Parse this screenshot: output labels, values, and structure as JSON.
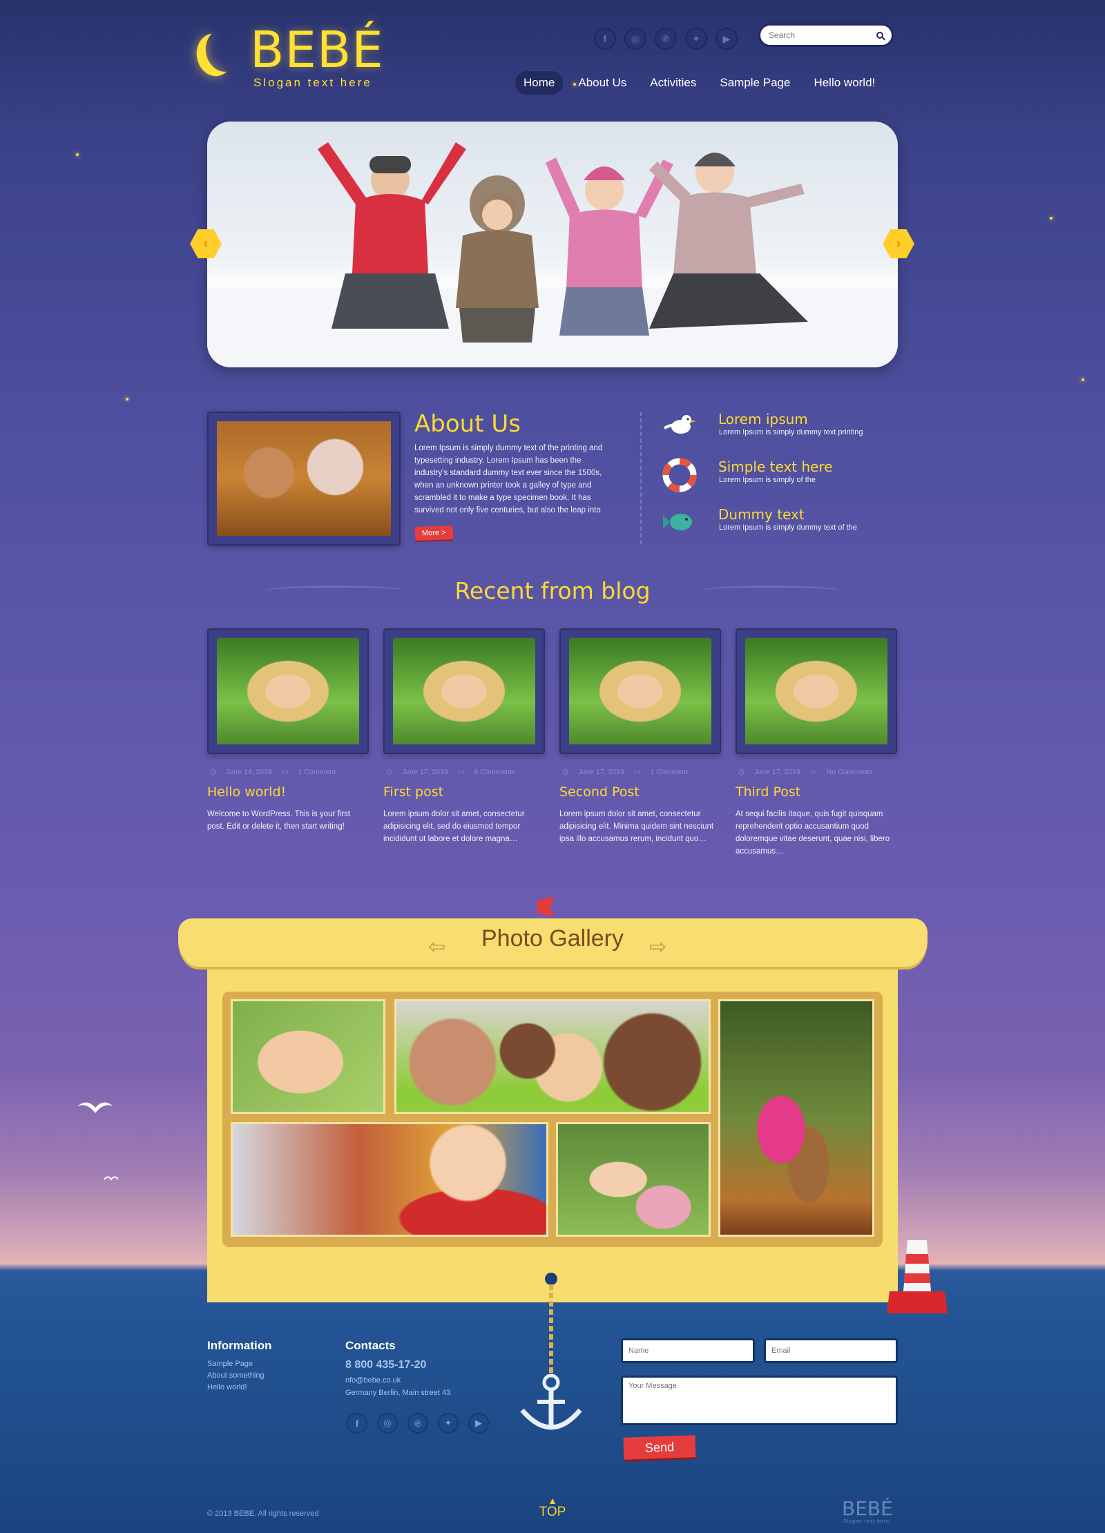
{
  "brand": {
    "logo": "BEBÉ",
    "slogan": "Slogan text here"
  },
  "search": {
    "placeholder": "Search"
  },
  "social": [
    "facebook-icon",
    "instagram-icon",
    "pinterest-icon",
    "twitter-icon",
    "youtube-icon"
  ],
  "social_glyphs": [
    "f",
    "◎",
    "℗",
    "✦",
    "▶"
  ],
  "nav": [
    {
      "label": "Home",
      "active": true
    },
    {
      "label": "About Us",
      "active": false
    },
    {
      "label": "Activities",
      "active": false
    },
    {
      "label": "Sample Page",
      "active": false
    },
    {
      "label": "Hello world!",
      "active": false
    }
  ],
  "slider": {
    "prev": "‹",
    "next": "›"
  },
  "about": {
    "title": "About Us",
    "text": "Lorem Ipsum is simply dummy text of the printing and typesetting industry. Lorem Ipsum has been the industry's standard dummy text ever since the 1500s, when an unknown printer took a galley of type and scrambled it to make a type specimen book. It has survived not only five centuries, but also the leap into",
    "more": "More >"
  },
  "features": [
    {
      "icon": "seagull-icon",
      "title": "Lorem ipsum",
      "text": "Lorem Ipsum is simply dummy text printing"
    },
    {
      "icon": "lifebuoy-icon",
      "title": "Simple text here",
      "text": "Lorem Ipsum is simply of the"
    },
    {
      "icon": "fish-icon",
      "title": "Dummy text",
      "text": "Lorem Ipsum is simply dummy text of the"
    }
  ],
  "blog": {
    "heading": "Recent from blog",
    "posts": [
      {
        "date": "June 14, 2019",
        "comments": "1 Comment",
        "title": "Hello world!",
        "text": "Welcome to WordPress. This is your first post. Edit or delete it, then start writing!"
      },
      {
        "date": "June 17, 2019",
        "comments": "6 Comments",
        "title": "First post",
        "text": "Lorem ipsum dolor sit amet, consectetur adipisicing elit, sed do eiusmod tempor incididunt ut labore et dolore magna…"
      },
      {
        "date": "June 17, 2019",
        "comments": "1 Comment",
        "title": "Second Post",
        "text": "Lorem ipsum dolor sit amet, consectetur adipisicing elit. Minima quidem sint nesciunt ipsa illo accusamus rerum, incidunt quo…"
      },
      {
        "date": "June 17, 2019",
        "comments": "No Comments",
        "title": "Third Post",
        "text": "At sequi facilis itaque, quis fugit quisquam reprehenderit optio accusantium quod doloremque vitae deserunt, quae nisi, libero accusamus…"
      }
    ]
  },
  "gallery": {
    "title": "Photo Gallery",
    "prev": "⇦",
    "next": "⇨"
  },
  "footer": {
    "info_heading": "Information",
    "info_links": [
      "Sample Page",
      "About something",
      "Hello world!"
    ],
    "contacts_heading": "Contacts",
    "phone": "8 800 435-17-20",
    "email": "nfo@bebe.co.uk",
    "address": "Germany Berlin, Main street 43",
    "form": {
      "name_placeholder": "Name",
      "email_placeholder": "Email",
      "message_placeholder": "Your Message",
      "send": "Send"
    },
    "copyright": "© 2013 BEBE. All rights reserved",
    "top": "TOP",
    "logo": "BEBÉ",
    "slogan": "Slogan text here"
  },
  "colors": {
    "accent_yellow": "#ffd932",
    "button_red": "#e53d3d",
    "nav_active": "#222a5e",
    "sea": "#1e4b88"
  }
}
